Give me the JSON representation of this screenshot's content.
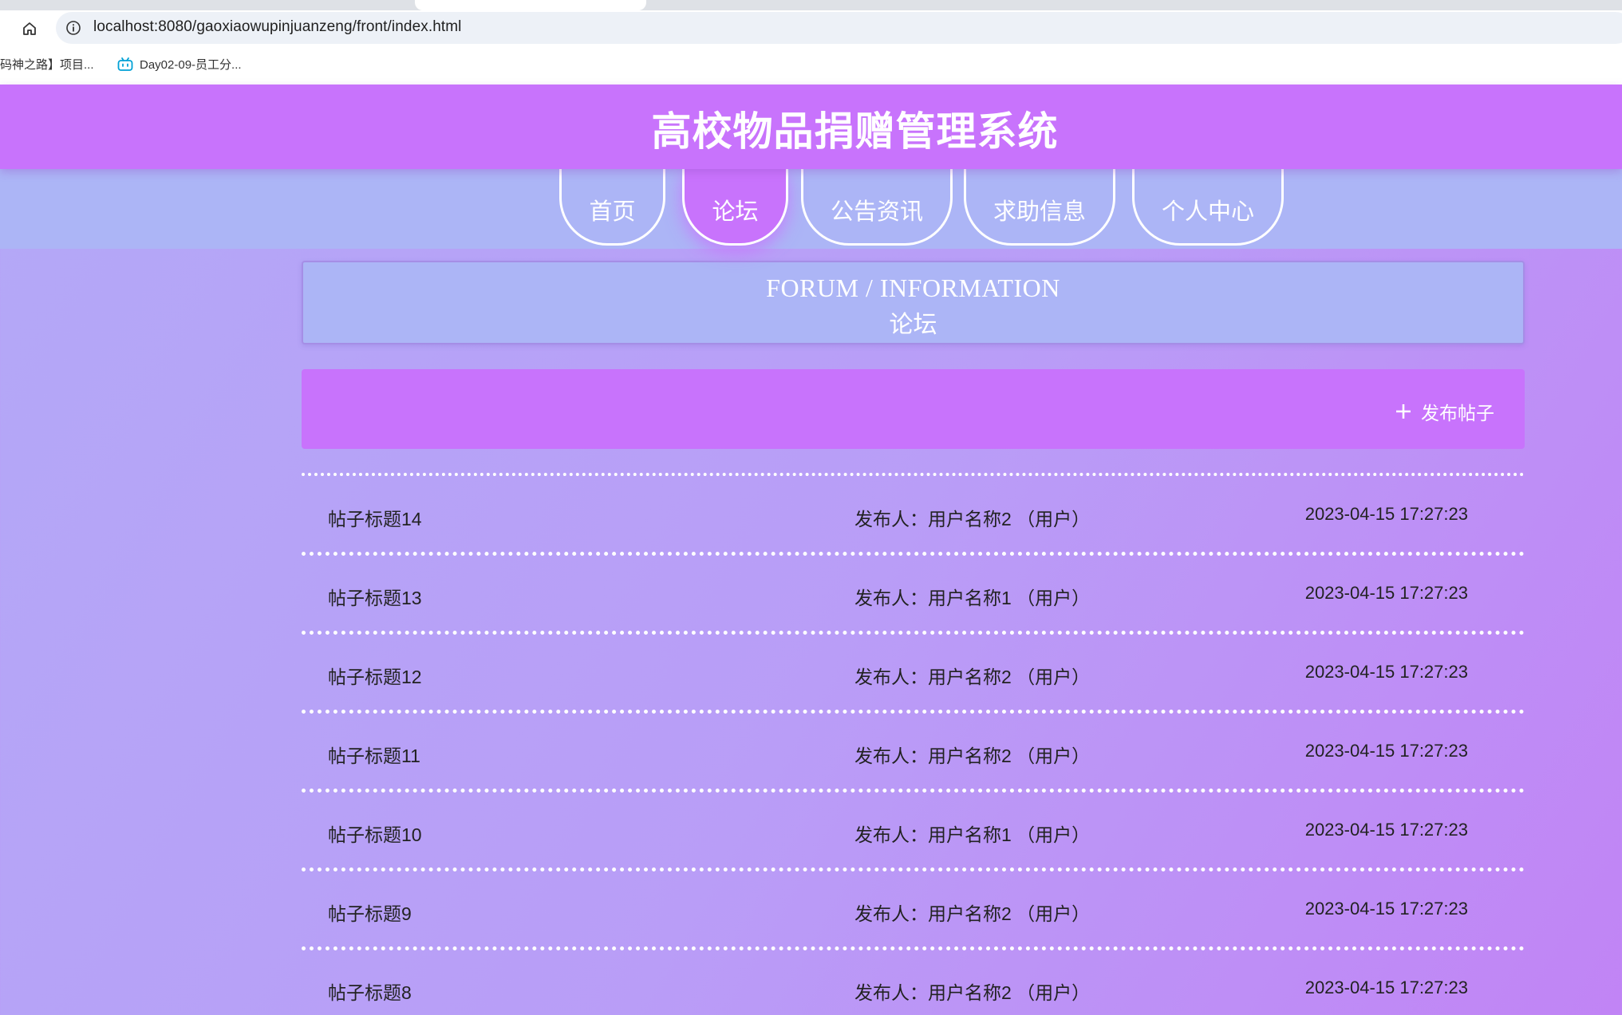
{
  "browser": {
    "url": "localhost:8080/gaoxiaowupinjuanzeng/front/index.html",
    "bookmarks": [
      {
        "label": "码神之路】项目..."
      },
      {
        "label": "Day02-09-员工分..."
      }
    ]
  },
  "header": {
    "title": "高校物品捐赠管理系统"
  },
  "nav": {
    "items": [
      {
        "label": "首页"
      },
      {
        "label": "论坛"
      },
      {
        "label": "公告资讯"
      },
      {
        "label": "求助信息"
      },
      {
        "label": "个人中心"
      }
    ],
    "active": "论坛"
  },
  "section": {
    "title_en": "FORUM / INFORMATION",
    "title_zh": "论坛"
  },
  "actions": {
    "publish_label": "发布帖子"
  },
  "posts": [
    {
      "title": "帖子标题14",
      "author": "发布人：用户名称2 （用户）",
      "time": "2023-04-15 17:27:23"
    },
    {
      "title": "帖子标题13",
      "author": "发布人：用户名称1 （用户）",
      "time": "2023-04-15 17:27:23"
    },
    {
      "title": "帖子标题12",
      "author": "发布人：用户名称2 （用户）",
      "time": "2023-04-15 17:27:23"
    },
    {
      "title": "帖子标题11",
      "author": "发布人：用户名称2 （用户）",
      "time": "2023-04-15 17:27:23"
    },
    {
      "title": "帖子标题10",
      "author": "发布人：用户名称1 （用户）",
      "time": "2023-04-15 17:27:23"
    },
    {
      "title": "帖子标题9",
      "author": "发布人：用户名称2 （用户）",
      "time": "2023-04-15 17:27:23"
    },
    {
      "title": "帖子标题8",
      "author": "发布人：用户名称2 （用户）",
      "time": "2023-04-15 17:27:23"
    }
  ],
  "colors": {
    "header_bg": "#c873fc",
    "nav_band_bg": "#acb5f6",
    "page_bg_start": "#b3a9f7",
    "page_bg_end": "#c184f5"
  }
}
